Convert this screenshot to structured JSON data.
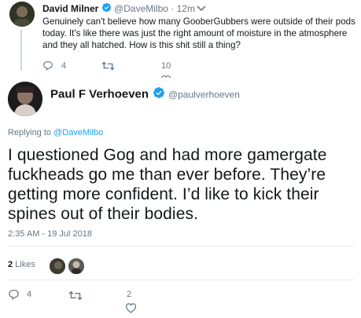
{
  "parent_tweet": {
    "author_name": "David Milner",
    "author_handle": "@DaveMilbo",
    "separator": "·",
    "time": "12m",
    "text": "Genuinely can't believe how many GooberGubbers were outside of their pods today. It's like there was just the right amount of moisture in the atmosphere and they all hatched. How is this shit still a thing?",
    "reply_count": "4",
    "like_count": "10"
  },
  "main_tweet": {
    "author_name": "Paul F Verhoeven",
    "author_handle": "@paulverhoeven",
    "replying_prefix": "Replying to",
    "replying_handle": "@DaveMilbo",
    "text": "I questioned Gog and had more gamergate fuckheads go me than ever before. They’re getting more confident. I’d like to kick their spines out of their bodies.",
    "timestamp": "2:35 AM - 19 Jul 2018",
    "likes_count": "2",
    "likes_label": "Likes",
    "reply_count": "4",
    "like_count": "2"
  },
  "colors": {
    "accent": "#1da1f2",
    "muted": "#657786",
    "divider": "#e6ecf0"
  }
}
